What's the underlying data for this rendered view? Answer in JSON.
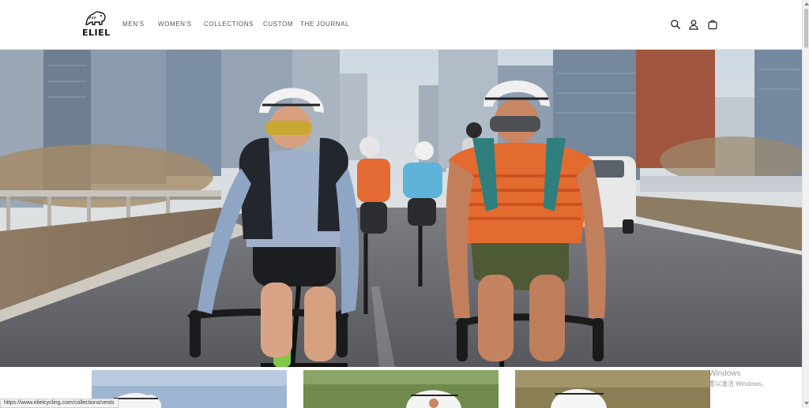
{
  "brand": {
    "name": "ELIEL",
    "logo_icon": "bear-icon"
  },
  "nav": {
    "items": [
      {
        "label": "MEN'S"
      },
      {
        "label": "WOMEN'S"
      },
      {
        "label": "COLLECTIONS"
      },
      {
        "label": "CUSTOM"
      },
      {
        "label": "THE JOURNAL"
      }
    ]
  },
  "header_icons": [
    "search-icon",
    "account-icon",
    "cart-icon"
  ],
  "hero": {
    "image": "group-of-cyclists-riding-on-city-bridge"
  },
  "products": [
    "cyclist-photo",
    "cyclist-photo",
    "cyclist-photo"
  ],
  "watermark": {
    "line1": "Windows",
    "line2": "置以激活 Windows。"
  },
  "status_bar": {
    "url": "https://www.elielcycling.com/collections/vests"
  },
  "colors": {
    "header_bg": "#ffffff",
    "nav_text": "#555555",
    "text": "#2b2b2b"
  }
}
